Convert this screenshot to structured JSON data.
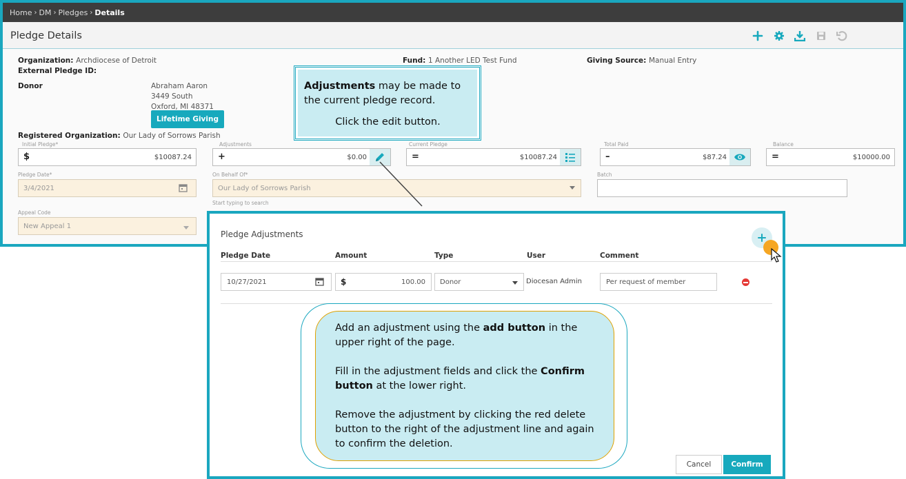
{
  "breadcrumb": {
    "items": [
      "Home",
      "DM",
      "Pledges"
    ],
    "current": "Details"
  },
  "page": {
    "title": "Pledge Details"
  },
  "record": {
    "organization_label": "Organization:",
    "organization": "Archdiocese of Detroit",
    "external_id_label": "External Pledge ID:",
    "fund_label": "Fund:",
    "fund": "1 Another LED Test Fund",
    "giving_source_label": "Giving Source:",
    "giving_source": "Manual Entry",
    "donor_label": "Donor",
    "donor_name": "Abraham Aaron",
    "donor_address1": "3449 South",
    "donor_address2": "Oxford, MI 48371",
    "lifetime_button": "Lifetime Giving",
    "registered_org_label": "Registered Organization:",
    "registered_org": "Our Lady of Sorrows Parish"
  },
  "fields": {
    "initial_pledge": {
      "caption": "Initial Pledge*",
      "symbol": "$",
      "value": "$10087.24"
    },
    "adjustments": {
      "caption": "Adjustments",
      "symbol": "+",
      "value": "$0.00"
    },
    "current_pledge": {
      "caption": "Current Pledge",
      "symbol": "=",
      "value": "$10087.24"
    },
    "total_paid": {
      "caption": "Total Paid",
      "symbol": "–",
      "value": "$87.24"
    },
    "balance": {
      "caption": "Balance",
      "symbol": "=",
      "value": "$10000.00"
    },
    "pledge_date": {
      "caption": "Pledge Date*",
      "value": "3/4/2021"
    },
    "on_behalf_of": {
      "caption": "On Behalf Of*",
      "value": "Our Lady of Sorrows Parish",
      "hint": "Start typing to search"
    },
    "batch": {
      "caption": "Batch",
      "value": ""
    },
    "appeal_code": {
      "caption": "Appeal Code",
      "value": "New Appeal 1"
    }
  },
  "callout1": {
    "bold": "Adjustments",
    "text": " may be made to the current pledge record.",
    "line2": "Click the edit button."
  },
  "adjustments_panel": {
    "title": "Pledge Adjustments",
    "columns": [
      "Pledge Date",
      "Amount",
      "Type",
      "User",
      "Comment"
    ],
    "row": {
      "date": "10/27/2021",
      "currency": "$",
      "amount": "100.00",
      "type": "Donor",
      "user": "Diocesan Admin",
      "comment": "Per request of member"
    },
    "cancel_label": "Cancel",
    "confirm_label": "Confirm"
  },
  "callout2": {
    "p1_a": "Add an adjustment using the ",
    "p1_b": "add button",
    "p1_c": " in the upper right of the page.",
    "p2_a": "Fill in the adjustment fields and click the ",
    "p2_b": "Confirm button",
    "p2_c": " at the lower right.",
    "p3": "Remove the adjustment by clicking the red delete button to the right of the adjustment line and again to confirm the deletion."
  },
  "icons": {
    "accent": "#17a9bd",
    "callout_bg": "#c9ecf2",
    "delete_red": "#e53935"
  }
}
